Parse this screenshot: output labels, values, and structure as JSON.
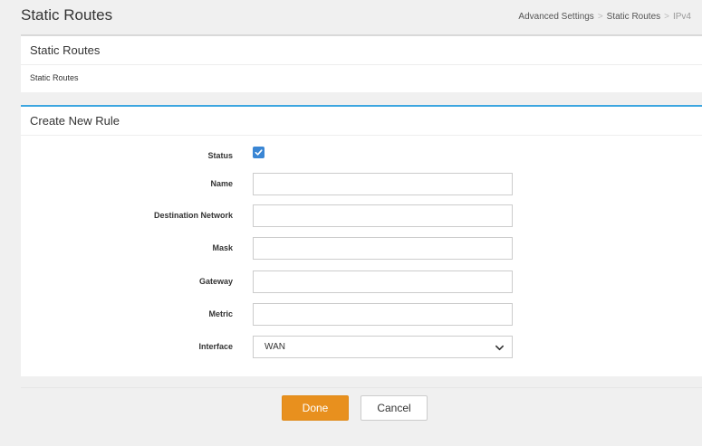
{
  "header": {
    "title": "Static Routes",
    "breadcrumb": [
      "Advanced Settings",
      "Static Routes",
      "IPv4"
    ]
  },
  "panel_list": {
    "title": "Static Routes",
    "body_text": "Static Routes"
  },
  "panel_form": {
    "title": "Create New Rule",
    "fields": {
      "status": {
        "label": "Status",
        "checked": true
      },
      "name": {
        "label": "Name",
        "value": ""
      },
      "destination": {
        "label": "Destination Network",
        "value": ""
      },
      "mask": {
        "label": "Mask",
        "value": ""
      },
      "gateway": {
        "label": "Gateway",
        "value": ""
      },
      "metric": {
        "label": "Metric",
        "value": ""
      },
      "interface": {
        "label": "Interface",
        "value": "WAN"
      }
    }
  },
  "buttons": {
    "done": "Done",
    "cancel": "Cancel"
  },
  "colors": {
    "accent_blue": "#3ca6e0",
    "checkbox_blue": "#3a86d4",
    "done_orange": "#e8901e"
  }
}
